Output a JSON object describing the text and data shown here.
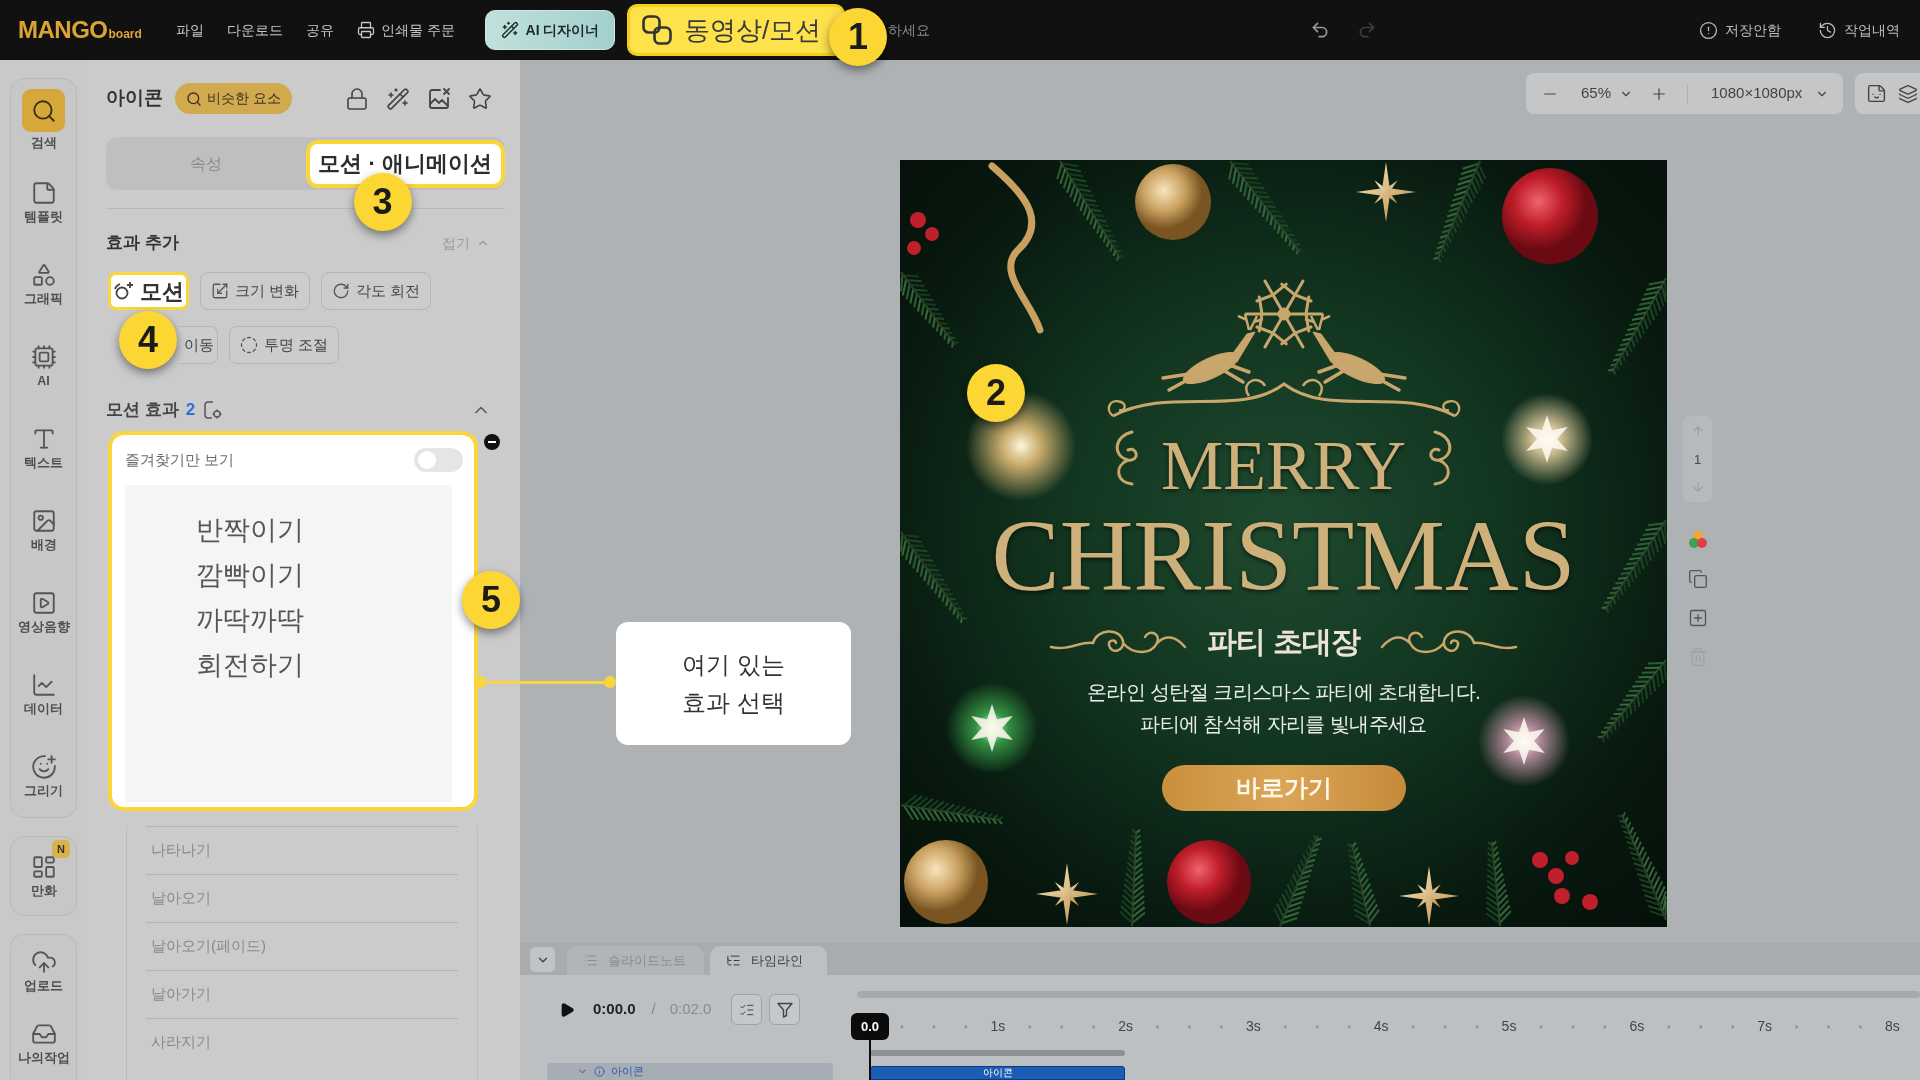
{
  "top_bar": {
    "logo": {
      "main": "MANGO",
      "sub": "board"
    },
    "menu": [
      "파일",
      "다운로드",
      "공유"
    ],
    "print": "인쇄물 주문",
    "actions": [
      {
        "kind": "ai",
        "label": "AI 디자이너",
        "highlighted": false
      },
      {
        "kind": "video",
        "label": "동영상/모션",
        "highlighted": true,
        "badge": "1"
      }
    ],
    "search_hint": "하세요",
    "history_buttons": [
      {
        "kind": "undo",
        "disabled": false
      },
      {
        "kind": "redo",
        "disabled": true
      }
    ],
    "save_status": "저장안함",
    "history": "작업내역"
  },
  "rail": {
    "groups": [
      {
        "items": [
          {
            "label": "검색",
            "selected": true
          },
          {
            "label": "템플릿",
            "selected": false
          },
          {
            "label": "그래픽",
            "selected": false
          },
          {
            "label": "AI",
            "selected": false
          },
          {
            "label": "텍스트",
            "selected": false
          },
          {
            "label": "배경",
            "selected": false
          },
          {
            "label": "영상음향",
            "selected": false
          },
          {
            "label": "데이터",
            "selected": false
          },
          {
            "label": "그리기",
            "selected": false
          }
        ]
      },
      {
        "items": [
          {
            "label": "만화",
            "selected": false,
            "badge": "N"
          }
        ]
      },
      {
        "items": [
          {
            "label": "업로드",
            "selected": false
          },
          {
            "label": "나의작업",
            "selected": false
          }
        ]
      }
    ]
  },
  "panel": {
    "title": "아이콘",
    "similar_button": "비슷한 요소",
    "tabs": [
      {
        "label": "속성",
        "selected": false,
        "highlighted": false
      },
      {
        "label": "모션 · 애니메이션",
        "selected": true,
        "highlighted": true,
        "badge": "3"
      }
    ],
    "add_effects": {
      "title": "효과 추가",
      "collapse": "접기",
      "buttons": [
        {
          "label": "모션",
          "highlighted": true,
          "badge": "4"
        },
        {
          "label": "크기 변화",
          "highlighted": false
        },
        {
          "label": "각도 회전",
          "highlighted": false
        },
        {
          "label": "이동",
          "highlighted": false
        },
        {
          "label": "투명 조절",
          "highlighted": false
        }
      ]
    },
    "motion_effects": {
      "title": "모션 효과",
      "count": "2",
      "expanded": true
    },
    "effect_menu": {
      "favorites_label": "즐겨찾기만 보기",
      "favorites_only": false,
      "badge": "5",
      "tooltip": "여기 있는 효과 선택",
      "options": [
        "반짝이기",
        "깜빡이기",
        "까딱까딱",
        "회전하기"
      ]
    },
    "more_options": [
      "나타나기",
      "날아오기",
      "날아오기(페이드)",
      "날아가기",
      "사라지기"
    ]
  },
  "canvas": {
    "zoom": "65%",
    "page_size": "1080×1080px",
    "page_number": "1",
    "design": {
      "badge": "2",
      "title_top": "MERRY",
      "title_main": "CHRISTMAS",
      "subtitle": "파티 초대장",
      "lines": [
        "온라인 성탄절 크리스마스 파티에 초대합니다.",
        "파티에 참석해 자리를 빛내주세요"
      ],
      "button": "바로가기"
    }
  },
  "timeline": {
    "tabs": [
      {
        "label": "슬라이드노트",
        "selected": false
      },
      {
        "label": "타임라인",
        "selected": true
      }
    ],
    "current_time": "0:00.0",
    "separator": "/",
    "duration": "0:02.0",
    "playhead": "0.0",
    "ticks": [
      "1s",
      "2s",
      "3s",
      "4s",
      "5s",
      "6s",
      "7s",
      "8s"
    ],
    "layer": "아이콘",
    "clip": "아이콘"
  }
}
